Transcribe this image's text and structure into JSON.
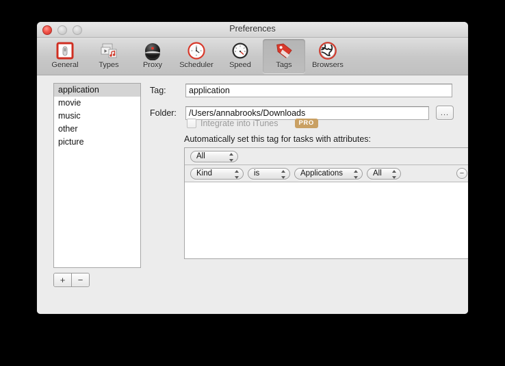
{
  "window": {
    "title": "Preferences",
    "controls": [
      {
        "name": "close",
        "color": "#f2564b"
      },
      {
        "name": "minimize",
        "color": "#d3d3d3"
      },
      {
        "name": "zoom",
        "color": "#d3d3d3"
      }
    ]
  },
  "toolbar": {
    "items": [
      {
        "label": "General",
        "icon": "general-icon",
        "selected": false
      },
      {
        "label": "Types",
        "icon": "types-icon",
        "selected": false
      },
      {
        "label": "Proxy",
        "icon": "proxy-icon",
        "selected": false
      },
      {
        "label": "Scheduler",
        "icon": "scheduler-icon",
        "selected": false
      },
      {
        "label": "Speed",
        "icon": "speed-icon",
        "selected": false
      },
      {
        "label": "Tags",
        "icon": "tags-icon",
        "selected": true
      },
      {
        "label": "Browsers",
        "icon": "browsers-icon",
        "selected": false
      }
    ]
  },
  "tag_list": {
    "items": [
      {
        "label": "application",
        "selected": true
      },
      {
        "label": "movie",
        "selected": false
      },
      {
        "label": "music",
        "selected": false
      },
      {
        "label": "other",
        "selected": false
      },
      {
        "label": "picture",
        "selected": false
      }
    ],
    "add_label": "+",
    "remove_label": "−"
  },
  "form": {
    "tag_label": "Tag:",
    "tag_value": "application",
    "tag_placeholder": "",
    "folder_label": "Folder:",
    "folder_value": "/Users/annabrooks/Downloads",
    "folder_placeholder": "",
    "browse_label": "...",
    "itunes_label": "Integrate into iTunes",
    "itunes_checked": false,
    "pro_badge": "PRO",
    "pro_badge_color": "#c9a063",
    "rules_heading": "Automatically set this tag for tasks with attributes:"
  },
  "rules": [
    {
      "popups": [
        "All"
      ],
      "add_label": "+",
      "remove_label": "",
      "has_remove": false
    },
    {
      "popups": [
        "Kind",
        "is",
        "Applications",
        "All"
      ],
      "add_label": "+",
      "remove_label": "−",
      "has_remove": true
    }
  ]
}
